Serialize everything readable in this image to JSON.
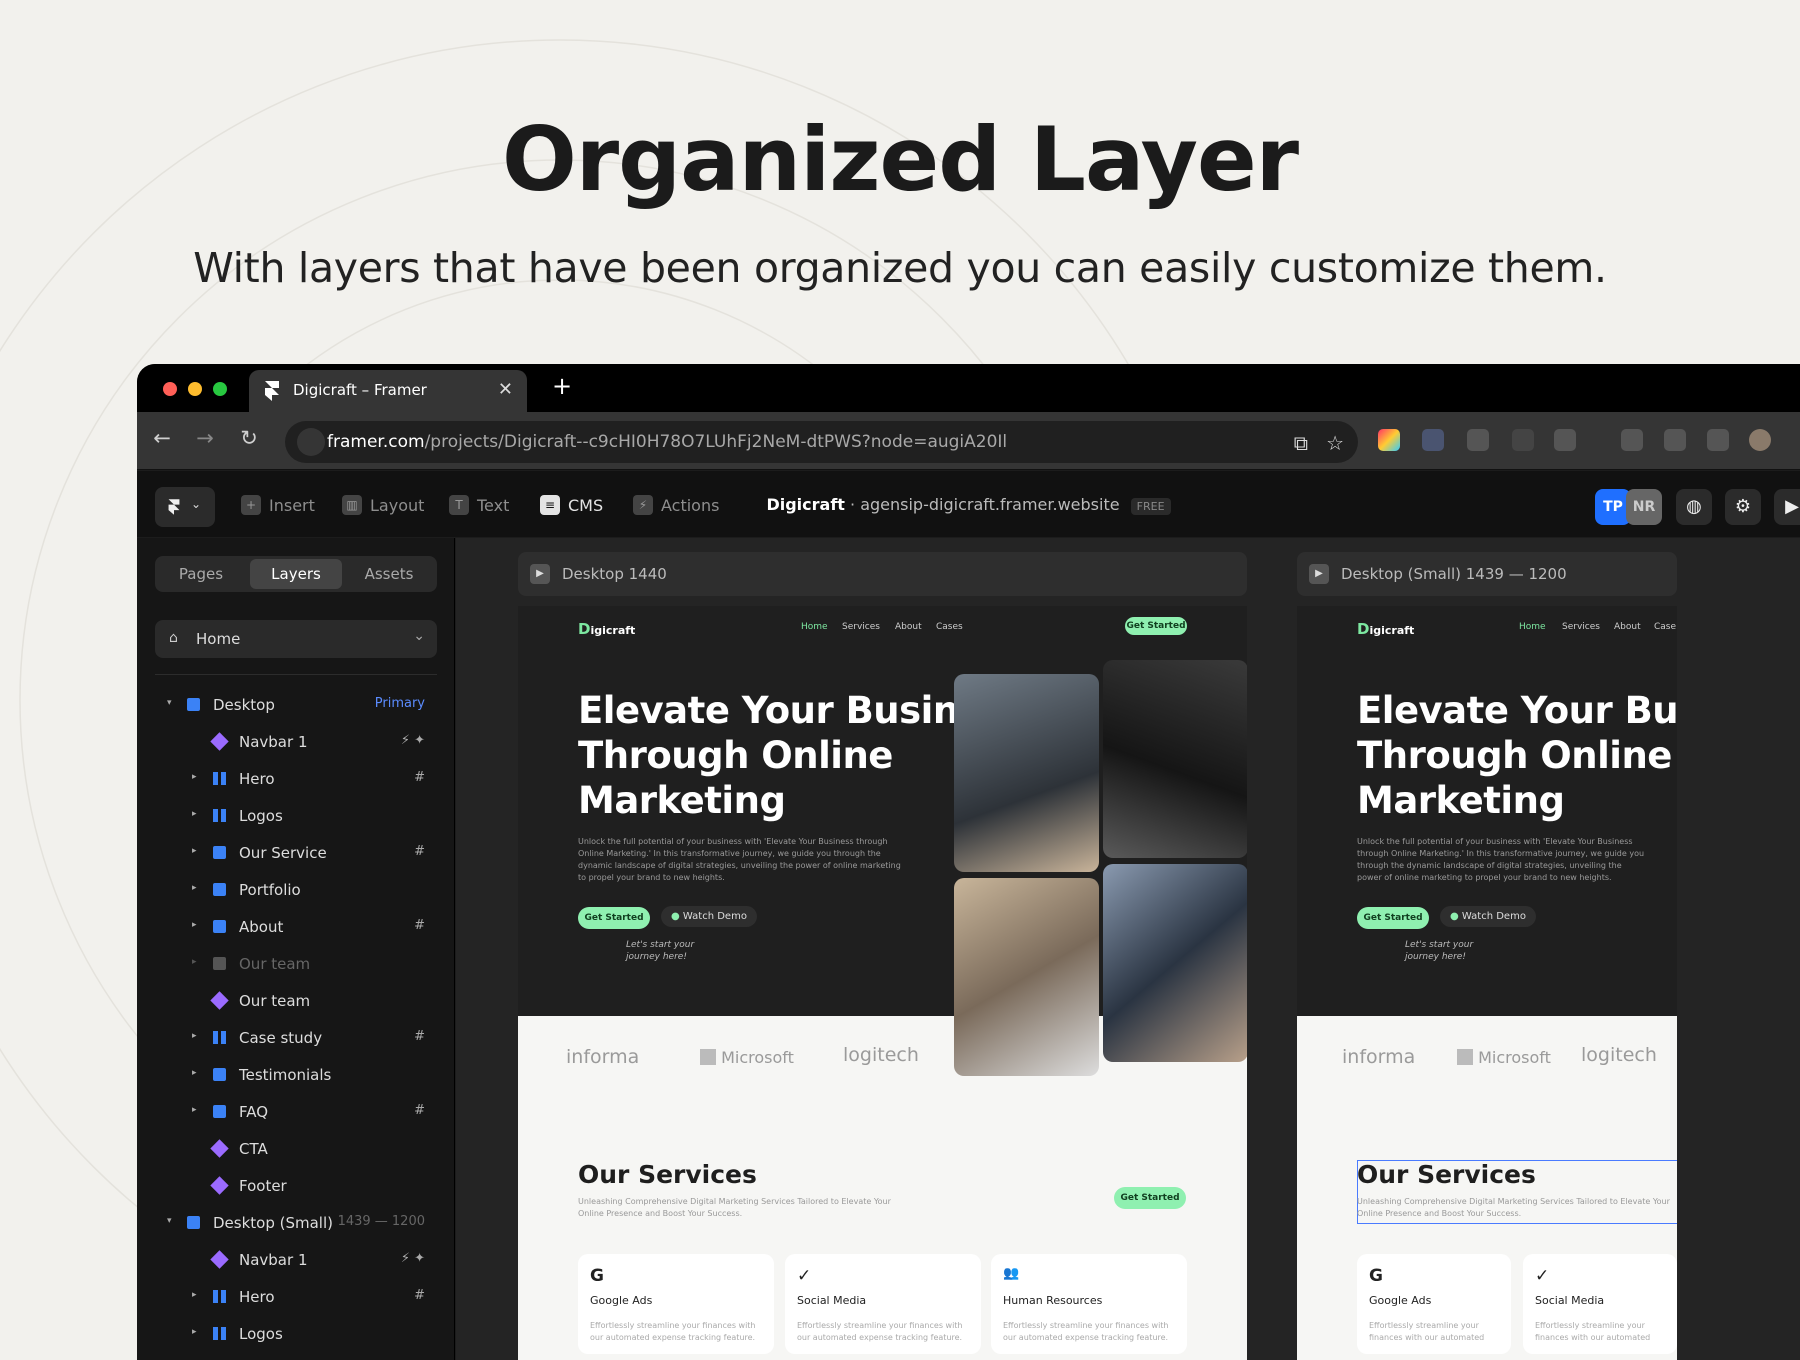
{
  "headline": "Organized Layer",
  "subheadline": "With layers that have been organized you can easily customize them.",
  "browser": {
    "tab_title": "Digicraft – Framer",
    "tab_close": "✕",
    "new_tab": "+",
    "url_domain": "framer.com",
    "url_path": "/projects/Digicraft--c9cHI0H78O7LUhFj2NeM-dtPWS?node=augiA20Il"
  },
  "toolbar": {
    "insert": "Insert",
    "layout": "Layout",
    "text": "Text",
    "cms": "CMS",
    "actions": "Actions",
    "project_name": "Digicraft",
    "separator": "·",
    "site_url": "agensip-digicraft.framer.website",
    "plan": "FREE",
    "avatar_1": "TP",
    "avatar_2": "NR"
  },
  "sidebar": {
    "tabs": [
      "Pages",
      "Layers",
      "Assets"
    ],
    "page": "Home",
    "layers": [
      {
        "label": "Desktop",
        "right": "Primary"
      },
      {
        "label": "Navbar 1",
        "right": "⚡ ✦"
      },
      {
        "label": "Hero",
        "right": "#"
      },
      {
        "label": "Logos",
        "right": ""
      },
      {
        "label": "Our Service",
        "right": "#"
      },
      {
        "label": "Portfolio",
        "right": ""
      },
      {
        "label": "About",
        "right": "#"
      },
      {
        "label": "Our team",
        "right": ""
      },
      {
        "label": "Our team",
        "right": ""
      },
      {
        "label": "Case study",
        "right": "#"
      },
      {
        "label": "Testimonials",
        "right": ""
      },
      {
        "label": "FAQ",
        "right": "#"
      },
      {
        "label": "CTA",
        "right": ""
      },
      {
        "label": "Footer",
        "right": ""
      },
      {
        "label": "Desktop (Small)",
        "right": "1439 — 1200"
      },
      {
        "label": "Navbar 1",
        "right": "⚡ ✦"
      },
      {
        "label": "Hero",
        "right": "#"
      },
      {
        "label": "Logos",
        "right": ""
      }
    ]
  },
  "frames": {
    "desktop_label": "Desktop  1440",
    "small_label": "Desktop (Small)  1439 — 1200"
  },
  "site": {
    "logo": "igicraft",
    "nav": [
      "Home",
      "Services",
      "About",
      "Cases"
    ],
    "nav_small": [
      "Home",
      "Services",
      "About",
      "Case"
    ],
    "cta": "Get Started",
    "hero_line1": "Elevate Your Business",
    "hero_line2": "Through Online",
    "hero_line3": "Marketing",
    "hero_line1_small": "Elevate Your Busi",
    "hero_para": "Unlock the full potential of your business with 'Elevate Your Business through Online Marketing.' In this transformative journey, we guide you through the dynamic landscape of digital strategies, unveiling the power of online marketing to propel your brand to new heights.",
    "btn_primary": "Get Started",
    "btn_secondary": "Watch Demo",
    "handwritten": "Let's start your journey here!",
    "brands": [
      "informa",
      "Microsoft",
      "logitech"
    ],
    "services_title": "Our Services",
    "services_sub": "Unleashing Comprehensive Digital Marketing Services Tailored to Elevate Your Online Presence and Boost Your Success.",
    "services_cta": "Get Started",
    "cards": [
      {
        "icon": "G",
        "title": "Google Ads",
        "text": "Effortlessly streamline your finances with our automated expense tracking feature."
      },
      {
        "icon": "✓",
        "title": "Social Media",
        "text": "Effortlessly streamline your finances with our automated expense tracking feature."
      },
      {
        "icon": "👥",
        "title": "Human Resources",
        "text": "Effortlessly streamline your finances with our automated expense tracking feature."
      }
    ],
    "cards_small_text": "Effortlessly streamline your finances with our automated"
  },
  "colors": {
    "accent_green": "#8ff0b0",
    "framer_blue": "#1f6fff",
    "layer_blue": "#3b82f6",
    "component_purple": "#9b6bff"
  }
}
